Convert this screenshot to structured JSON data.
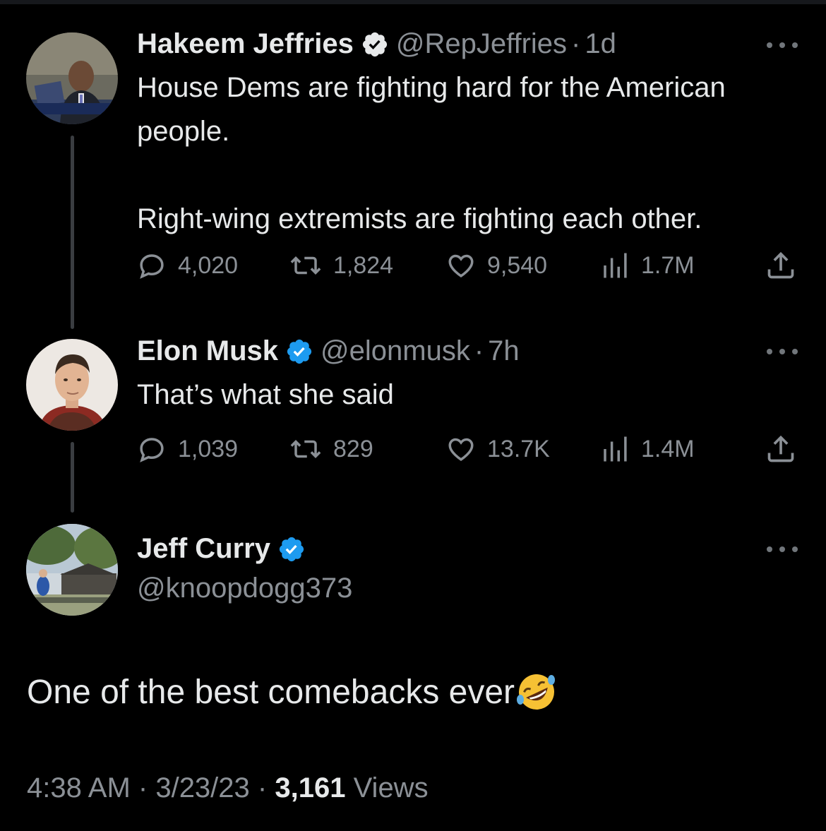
{
  "tweets": [
    {
      "name": "Hakeem Jeffries",
      "handle": "@RepJeffries",
      "time": "1d",
      "avatar": "hakeem-jeffries-avatar",
      "text": "House Dems are fighting hard for the American\npeople.\n\nRight-wing extremists are fighting each other.",
      "replies": "4,020",
      "retweets": "1,824",
      "likes": "9,540",
      "views": "1.7M"
    },
    {
      "name": "Elon Musk",
      "handle": "@elonmusk",
      "time": "7h",
      "avatar": "elon-musk-avatar",
      "text": "That’s what she said",
      "replies": "1,039",
      "retweets": "829",
      "likes": "13.7K",
      "views": "1.4M"
    }
  ],
  "main_tweet": {
    "name": "Jeff Curry",
    "handle": "@knoopdogg373",
    "avatar": "jeff-curry-avatar",
    "text": "One of the best comebacks ever",
    "emoji": "rolling-on-floor-laughing-emoji",
    "time": "4:38 AM",
    "date": "3/23/23",
    "views_count": "3,161",
    "views_label": "Views"
  },
  "icons": {
    "verified": "verified-badge-icon",
    "reply": "reply-icon",
    "retweet": "retweet-icon",
    "like": "heart-icon",
    "views": "views-chart-icon",
    "share": "share-icon",
    "more": "more-options-icon"
  },
  "colors": {
    "background": "#000000",
    "text": "#e7e9ea",
    "secondary_text": "#8b9096",
    "verified_blue": "#1d9bf0",
    "thread_line": "#3a3d41"
  }
}
